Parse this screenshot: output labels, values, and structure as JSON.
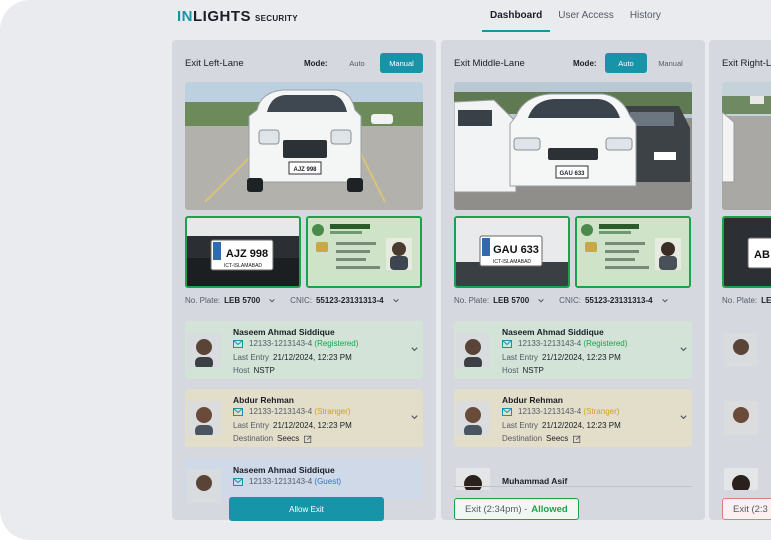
{
  "app": {
    "logo_main_in": "IN",
    "logo_main_rest": "LIGHTS",
    "logo_sub": "SECURITY"
  },
  "nav": {
    "tabs": [
      {
        "label": "Dashboard",
        "active": true
      },
      {
        "label": "User Access"
      },
      {
        "label": "History"
      }
    ]
  },
  "colors": {
    "accent": "#1794a8",
    "registered": "#1aa34a",
    "stranger": "#d4a017",
    "guest": "#2f78c4"
  },
  "lanes": [
    {
      "title": "Exit Left-Lane",
      "mode_label": "Mode:",
      "mode_auto": "Auto",
      "mode_manual": "Manual",
      "mode_selected": "Manual",
      "plate_label": "No. Plate:",
      "plate_value": "LEB 5700",
      "cnic_label": "CNIC:",
      "cnic_value": "55123-23131313-4",
      "plate_text": "AJZ 998",
      "plate_region": "ICT-ISLAMABAD",
      "people": [
        {
          "name": "Naseem Ahmad Siddique",
          "id": "12133-1213143-4",
          "status": "(Registered)",
          "last_entry_label": "Last Entry",
          "last_entry": "21/12/2024, 12:23 PM",
          "extra_label": "Host",
          "extra_value": "NSTP"
        },
        {
          "name": "Abdur Rehman",
          "id": "12133-1213143-4",
          "status": "(Stranger)",
          "last_entry_label": "Last Entry",
          "last_entry": "21/12/2024, 12:23 PM",
          "extra_label": "Destination",
          "extra_value": "Seecs"
        },
        {
          "name": "Naseem Ahmad Siddique",
          "id": "12133-1213143-4",
          "status": "(Guest)"
        }
      ],
      "action_button": "Allow Exit"
    },
    {
      "title": "Exit Middle-Lane",
      "mode_label": "Mode:",
      "mode_auto": "Auto",
      "mode_manual": "Manual",
      "mode_selected": "Auto",
      "plate_label": "No. Plate:",
      "plate_value": "LEB 5700",
      "cnic_label": "CNIC:",
      "cnic_value": "55123-23131313-4",
      "plate_text": "GAU 633",
      "plate_region": "ICT-ISLAMABAD",
      "people": [
        {
          "name": "Naseem Ahmad Siddique",
          "id": "12133-1213143-4",
          "status": "(Registered)",
          "last_entry_label": "Last Entry",
          "last_entry": "21/12/2024, 12:23 PM",
          "extra_label": "Host",
          "extra_value": "NSTP"
        },
        {
          "name": "Abdur Rehman",
          "id": "12133-1213143-4",
          "status": "(Stranger)",
          "last_entry_label": "Last Entry",
          "last_entry": "21/12/2024, 12:23 PM",
          "extra_label": "Destination",
          "extra_value": "Seecs"
        },
        {
          "name": "Muhammad Asif"
        }
      ],
      "exit_status_time": "Exit (2:34pm)  -",
      "exit_status_result": "Allowed"
    },
    {
      "title": "Exit Right-Lane",
      "plate_label": "No. Plate:",
      "plate_value": "LE",
      "plate_text": "AB",
      "exit_status_time": "Exit (2:3"
    }
  ]
}
